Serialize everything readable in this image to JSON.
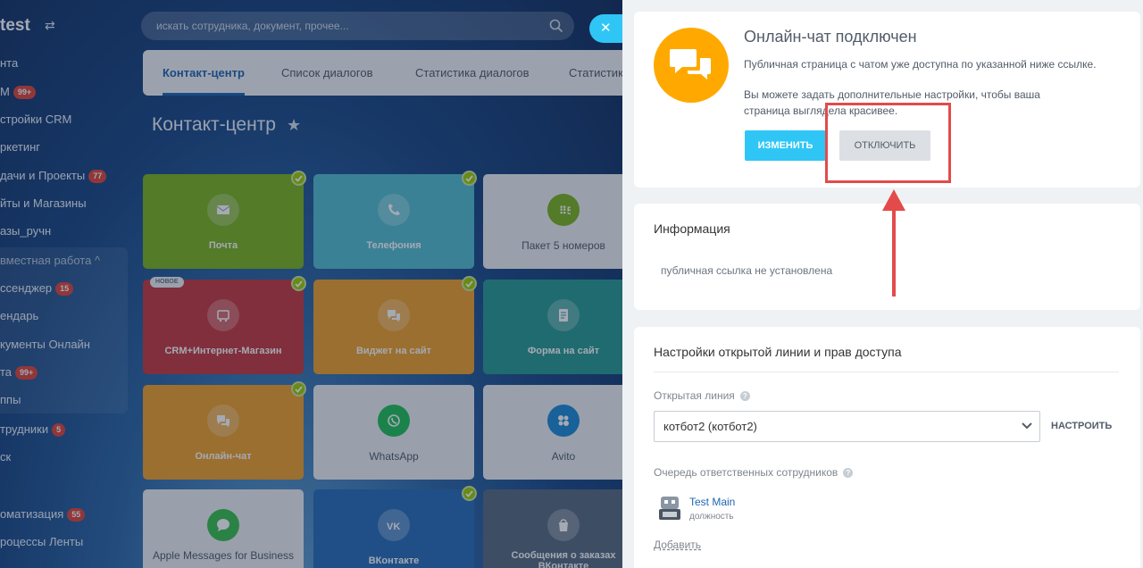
{
  "app": {
    "logo": "test",
    "search_placeholder": "искать сотрудника, документ, прочее...",
    "close_label": "✕"
  },
  "sidebar": {
    "items": [
      {
        "label": "нта",
        "badge": ""
      },
      {
        "label": "М",
        "badge": "99+"
      },
      {
        "label": "стройки CRM",
        "badge": ""
      },
      {
        "label": "ркетинг",
        "badge": ""
      },
      {
        "label": "дачи и Проекты",
        "badge": "77"
      },
      {
        "label": "йты и Магазины",
        "badge": ""
      },
      {
        "label": "азы_ручн",
        "badge": ""
      },
      {
        "label": "вместная работа ^",
        "badge": ""
      },
      {
        "label": "ссенджер",
        "badge": "15"
      },
      {
        "label": "ендарь",
        "badge": ""
      },
      {
        "label": "кументы Онлайн",
        "badge": ""
      },
      {
        "label": "та",
        "badge": "99+"
      },
      {
        "label": "ппы",
        "badge": ""
      },
      {
        "label": "трудники",
        "badge": "5"
      },
      {
        "label": "ск",
        "badge": ""
      },
      {
        "label": "оматизация",
        "badge": "55"
      },
      {
        "label": "роцессы Ленты",
        "badge": ""
      }
    ]
  },
  "tabs": [
    "Контакт-центр",
    "Список диалогов",
    "Статистика диалогов",
    "Статистик"
  ],
  "page_title": "Контакт-центр",
  "tiles": [
    {
      "label": "Почта",
      "color": "#7db51f",
      "icon": "mail-icon"
    },
    {
      "label": "Телефония",
      "color": "#55bfd0",
      "icon": "phone-icon"
    },
    {
      "label": "Пакет 5 номеров",
      "color": "#eef1f3",
      "icon": "package-icon"
    },
    {
      "label": "CRM+Интернет-Магазин",
      "color": "#c73a3f",
      "icon": "cart-icon",
      "badge": "НОВОЕ"
    },
    {
      "label": "Виджет на сайт",
      "color": "#f0a22a",
      "icon": "widget-icon"
    },
    {
      "label": "Форма на сайт",
      "color": "#2a9c93",
      "icon": "form-icon"
    },
    {
      "label": "Онлайн-чат",
      "color": "#f0a22a",
      "icon": "chat-icon"
    },
    {
      "label": "WhatsApp",
      "color": "#eef1f3",
      "icon": "whatsapp-icon"
    },
    {
      "label": "Avito",
      "color": "#eef1f3",
      "icon": "avito-icon"
    },
    {
      "label": "Apple Messages for Business",
      "color": "#eef1f3",
      "icon": "apple-messages-icon"
    },
    {
      "label": "ВКонтакте",
      "color": "#2a6fb8",
      "icon": "vk-icon"
    },
    {
      "label": "Сообщения о заказах ВКонтакте",
      "color": "#5a6b80",
      "icon": "vk-shop-icon"
    }
  ],
  "panel": {
    "status_card": {
      "title": "Онлайн-чат подключен",
      "text1": "Публичная страница с чатом уже доступна по указанной ниже ссылке.",
      "text2": "Вы можете задать дополнительные настройки, чтобы ваша страница выглядела красивее.",
      "change_button": "ИЗМЕНИТЬ",
      "disable_button": "ОТКЛЮЧИТЬ"
    },
    "info_card": {
      "title": "Информация",
      "link_text": "публичная ссылка не установлена"
    },
    "settings_card": {
      "title": "Настройки открытой линии и прав доступа",
      "line_label": "Открытая линия",
      "line_value": "котбот2 (котбот2)",
      "configure_label": "НАСТРОИТЬ",
      "queue_label": "Очередь ответственных сотрудников",
      "user_name": "Test Main",
      "user_position": "должность",
      "add_link": "Добавить"
    }
  },
  "colors": {
    "accent": "#2fc6f6",
    "link": "#2067b0",
    "chat_logo": "#ffa900",
    "annotation": "#e34b4b"
  }
}
